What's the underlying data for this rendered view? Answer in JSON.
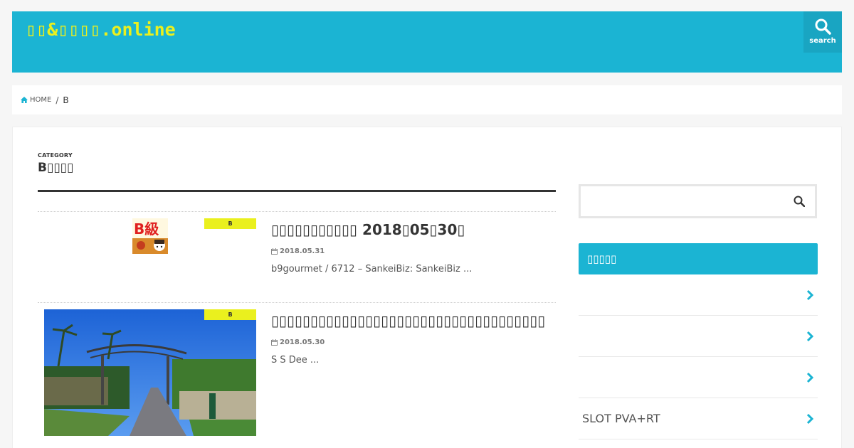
{
  "header": {
    "site_title": "▯▯&▯▯▯▯.online",
    "search_label": "search"
  },
  "breadcrumb": {
    "home_label": "HOME",
    "separator": "/",
    "current": "B"
  },
  "category": {
    "label": "CATEGORY",
    "title": "B▯▯▯▯"
  },
  "articles": [
    {
      "badge": "B",
      "title": "▯▯▯▯▯▯▯▯▯▯▯ 2018▯05▯30▯",
      "date": "2018.05.31",
      "excerpt": "b9gourmet /  6712  – SankeiBiz: SankeiBiz ...",
      "thumb_text": "B級"
    },
    {
      "badge": "B",
      "title": "▯▯▯▯▯▯▯▯▯▯▯▯▯▯▯▯▯▯▯▯▯▯▯▯▯▯▯▯▯▯▯▯▯▯▯",
      "date": "2018.05.30",
      "excerpt": " S S Dee ..."
    }
  ],
  "sidebar": {
    "search_placeholder": "",
    "widget_title": "▯▯▯▯▯",
    "items": [
      {
        "label": ""
      },
      {
        "label": ""
      },
      {
        "label": ""
      },
      {
        "label": "SLOT PVA+RT"
      }
    ]
  },
  "colors": {
    "brand": "#1bb4d3",
    "accent_yellow": "#eaf01e",
    "text": "#333333"
  },
  "icons": {
    "search": "search-icon",
    "home": "home-icon",
    "calendar": "calendar-icon",
    "chevron": "chevron-right-icon"
  }
}
